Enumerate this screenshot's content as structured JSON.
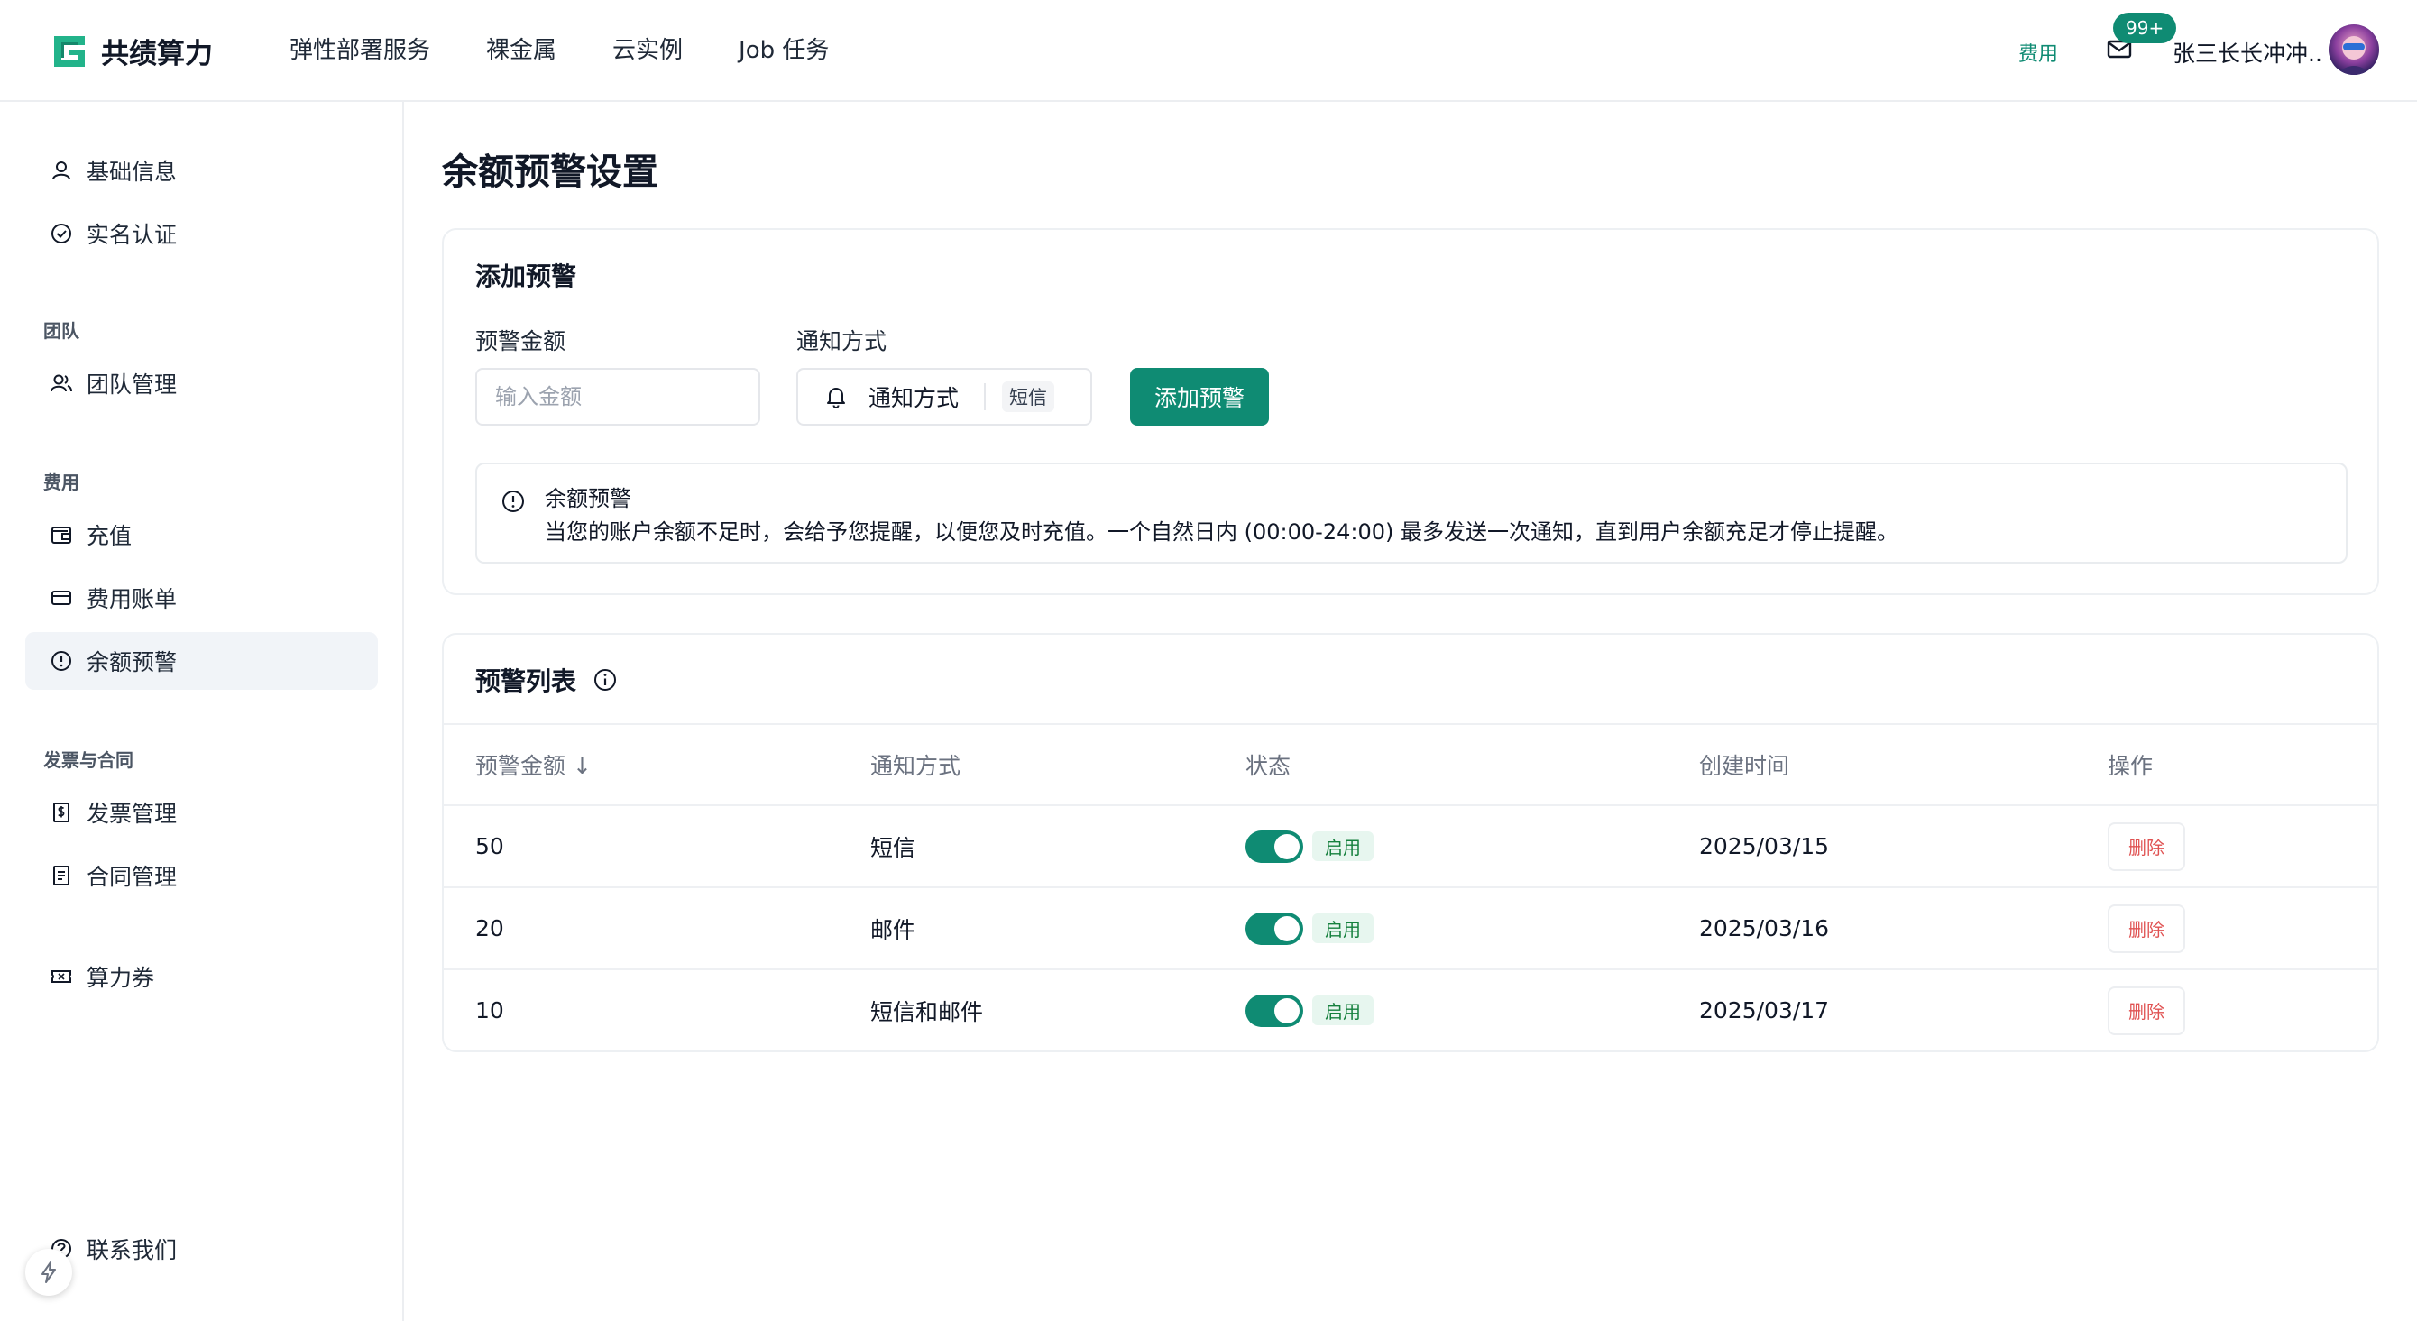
{
  "app": {
    "brand": "共绩算力",
    "accent_color": "#0f8b73"
  },
  "header": {
    "nav": [
      {
        "label": "弹性部署服务"
      },
      {
        "label": "裸金属"
      },
      {
        "label": "云实例"
      },
      {
        "label": "Job 任务"
      }
    ],
    "fee_link": "费用",
    "mail_badge": "99+",
    "user_name": "张三长长冲冲.."
  },
  "sidebar": {
    "items": [
      {
        "label": "基础信息",
        "icon": "user-icon"
      },
      {
        "label": "实名认证",
        "icon": "verified-icon"
      }
    ],
    "groups": [
      {
        "title": "团队",
        "items": [
          {
            "label": "团队管理",
            "icon": "team-icon"
          }
        ]
      },
      {
        "title": "费用",
        "items": [
          {
            "label": "充值",
            "icon": "wallet-icon"
          },
          {
            "label": "费用账单",
            "icon": "credit-card-icon"
          },
          {
            "label": "余额预警",
            "icon": "alert-circle-icon",
            "active": true
          }
        ]
      },
      {
        "title": "发票与合同",
        "items": [
          {
            "label": "发票管理",
            "icon": "invoice-icon"
          },
          {
            "label": "合同管理",
            "icon": "contract-icon"
          }
        ]
      }
    ],
    "extra": {
      "label": "算力券",
      "icon": "ticket-icon"
    },
    "contact": {
      "label": "联系我们",
      "icon": "help-icon"
    }
  },
  "main": {
    "page_title": "余额预警设置",
    "add_card": {
      "title": "添加预警",
      "amount_label": "预警金额",
      "amount_placeholder": "输入金额",
      "notify_label": "通知方式",
      "notify_select_text": "通知方式",
      "notify_selected_tag": "短信",
      "add_button": "添加预警",
      "alert_title": "余额预警",
      "alert_desc": "当您的账户余额不足时，会给予您提醒，以便您及时充值。一个自然日内 (00:00-24:00) 最多发送一次通知，直到用户余额充足才停止提醒。"
    },
    "list_card": {
      "title": "预警列表",
      "columns": [
        "预警金额 ↓",
        "通知方式",
        "状态",
        "创建时间",
        "操作"
      ],
      "rows": [
        {
          "amount": "50",
          "method": "短信",
          "enabled": true,
          "status": "启用",
          "created": "2025/03/15",
          "action": "删除"
        },
        {
          "amount": "20",
          "method": "邮件",
          "enabled": true,
          "status": "启用",
          "created": "2025/03/16",
          "action": "删除"
        },
        {
          "amount": "10",
          "method": "短信和邮件",
          "enabled": true,
          "status": "启用",
          "created": "2025/03/17",
          "action": "删除"
        }
      ]
    }
  }
}
